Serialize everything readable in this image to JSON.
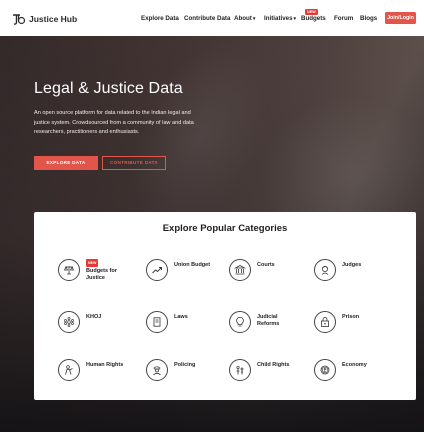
{
  "header": {
    "logo_text": "Justice Hub",
    "nav": [
      {
        "label": "Explore Data",
        "caret": false
      },
      {
        "label": "Contribute Data",
        "caret": false
      },
      {
        "label": "About",
        "caret": true
      },
      {
        "label": "Initiatives",
        "caret": true
      },
      {
        "label": "Budgets",
        "caret": false,
        "badge": "NEW"
      },
      {
        "label": "Forum",
        "caret": false
      },
      {
        "label": "Blogs",
        "caret": false
      }
    ],
    "join_label": "Join/Login"
  },
  "hero": {
    "title": "Legal & Justice Data",
    "description": "An open source platform for data related to the Indian legal and justice system. Crowdsourced from a community of law and data researchers, practitioners and enthusiasts.",
    "primary_button": "EXPLORE DATA",
    "secondary_button": "CONTRIBUTE DATA"
  },
  "categories": {
    "title": "Explore Popular Categories",
    "items": [
      {
        "label": "Budgets for Justice",
        "icon": "budget-justice-icon",
        "badge": "NEW"
      },
      {
        "label": "Union Budget",
        "icon": "trend-chart-icon"
      },
      {
        "label": "Courts",
        "icon": "courthouse-icon"
      },
      {
        "label": "Judges",
        "icon": "judge-icon"
      },
      {
        "label": "KHOJ",
        "icon": "network-icon"
      },
      {
        "label": "Laws",
        "icon": "law-book-icon"
      },
      {
        "label": "Judicial Reforms",
        "icon": "lightbulb-icon"
      },
      {
        "label": "Prison",
        "icon": "lock-icon"
      },
      {
        "label": "Human Rights",
        "icon": "human-rights-icon"
      },
      {
        "label": "Policing",
        "icon": "police-icon"
      },
      {
        "label": "Child Rights",
        "icon": "child-rights-icon"
      },
      {
        "label": "Economy",
        "icon": "economy-coin-icon"
      }
    ]
  },
  "colors": {
    "accent": "#e1554a",
    "badge": "#e53935"
  }
}
